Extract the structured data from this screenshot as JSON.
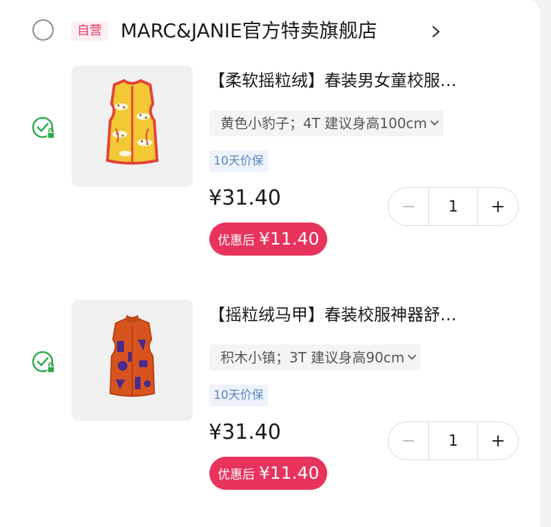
{
  "store": {
    "badge": "自营",
    "name": "MARC&JANIE官方特卖旗舰店",
    "selected": false
  },
  "items": [
    {
      "title": "【柔软摇粒绒】春装男女童校服…",
      "sku": "黄色小豹子；4T 建议身高100cm",
      "guarantee": "10天价保",
      "price": "¥31.40",
      "discount_label": "优惠后",
      "discount_price": "¥11.40",
      "quantity": "1",
      "selected": true,
      "image": "yellow-leopard-fleece-vest"
    },
    {
      "title": "【摇粒绒马甲】春装校服神器舒…",
      "sku": "积木小镇；3T 建议身高90cm",
      "guarantee": "10天价保",
      "price": "¥31.40",
      "discount_label": "优惠后",
      "discount_price": "¥11.40",
      "quantity": "1",
      "selected": true,
      "image": "orange-purple-fleece-vest"
    }
  ],
  "colors": {
    "accent": "#e8335d",
    "check_green": "#2eaa4a",
    "guarantee_blue": "#5b82c4"
  }
}
